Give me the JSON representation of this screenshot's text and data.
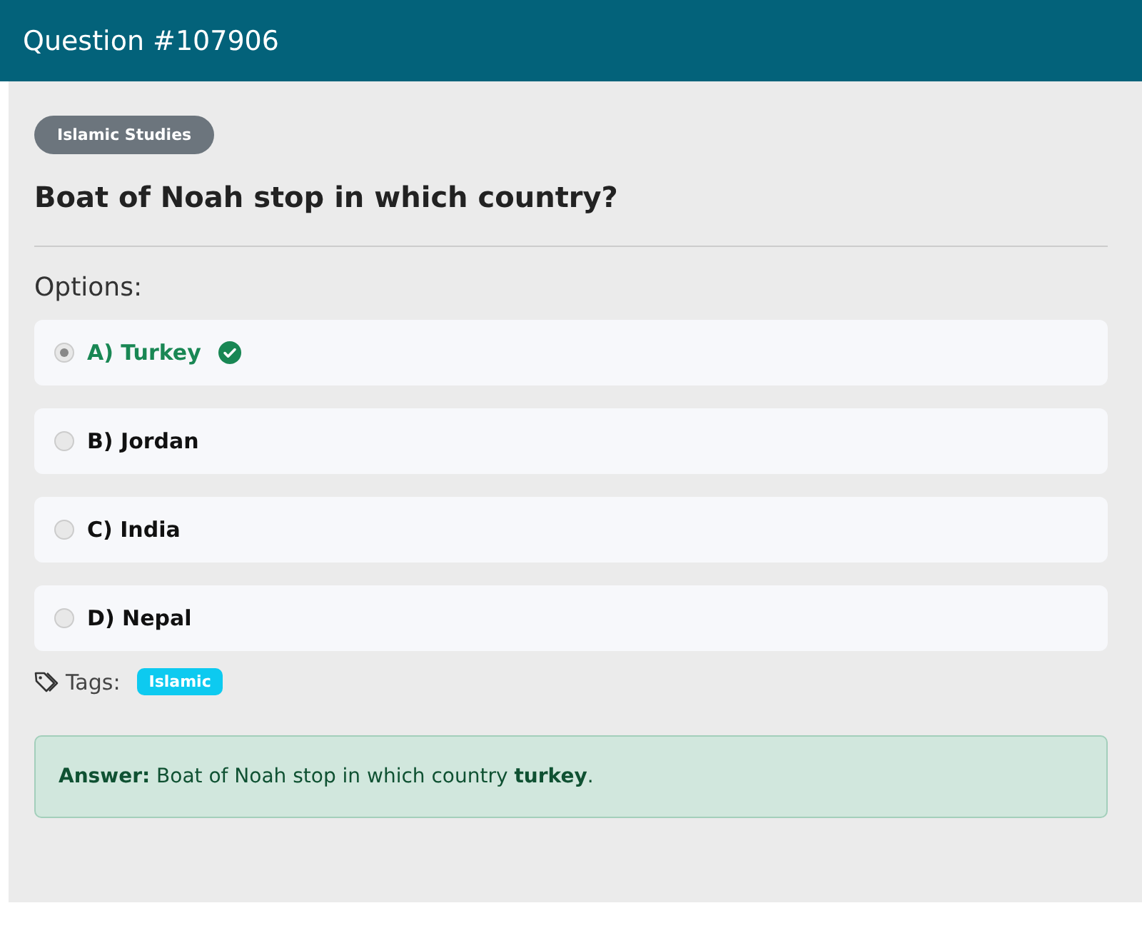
{
  "header": {
    "title": "Question #107906"
  },
  "category": "Islamic Studies",
  "question": "Boat of Noah stop in which country?",
  "options_label": "Options:",
  "options": [
    {
      "label": "A) Turkey",
      "selected": true,
      "correct": true
    },
    {
      "label": "B) Jordan",
      "selected": false,
      "correct": false
    },
    {
      "label": "C) India",
      "selected": false,
      "correct": false
    },
    {
      "label": "D) Nepal",
      "selected": false,
      "correct": false
    }
  ],
  "tags_label": "Tags:",
  "tags": [
    "Islamic"
  ],
  "answer": "**Answer:** Boat of Noah stop in which country **turkey**."
}
